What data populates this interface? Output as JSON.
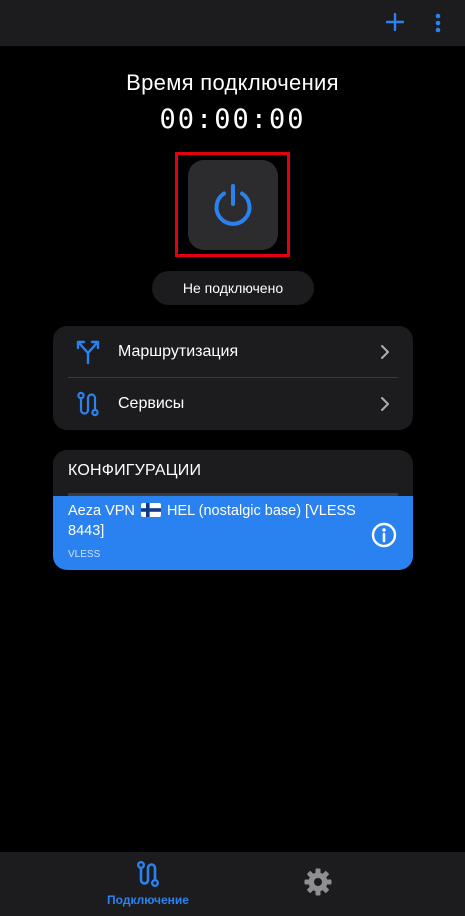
{
  "colors": {
    "accent": "#2a82f0",
    "background": "#000000",
    "surface": "#1c1c1e",
    "highlight_border": "#e3000f"
  },
  "topbar": {
    "add_icon": "plus-icon",
    "more_icon": "more-vertical-icon"
  },
  "timer": {
    "title": "Время подключения",
    "value": "00:00:00"
  },
  "power_button": {
    "icon": "power-icon"
  },
  "status": {
    "text": "Не подключено"
  },
  "menu": {
    "items": [
      {
        "label": "Маршрутизация",
        "icon": "routing-icon"
      },
      {
        "label": "Сервисы",
        "icon": "services-icon"
      }
    ]
  },
  "configurations": {
    "header": "КОНФИГУРАЦИИ",
    "items": [
      {
        "name_before_flag": "Aeza VPN",
        "flag": "finland-flag-icon",
        "name_after_flag": "HEL (nostalgic base) [VLESS 8443]",
        "protocol": "VLESS",
        "selected": true
      }
    ]
  },
  "bottom_nav": {
    "connect_label": "Подключение",
    "connect_icon": "connection-icon",
    "settings_icon": "gear-icon"
  }
}
